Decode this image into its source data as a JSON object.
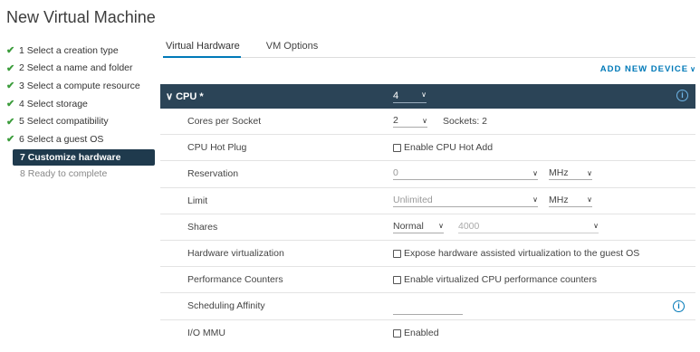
{
  "window": {
    "title": "New Virtual Machine"
  },
  "steps": [
    {
      "label": "1 Select a creation type",
      "done": true
    },
    {
      "label": "2 Select a name and folder",
      "done": true
    },
    {
      "label": "3 Select a compute resource",
      "done": true
    },
    {
      "label": "4 Select storage",
      "done": true
    },
    {
      "label": "5 Select compatibility",
      "done": true
    },
    {
      "label": "6 Select a guest OS",
      "done": true
    },
    {
      "label": "7 Customize hardware",
      "active": true
    },
    {
      "label": "8 Ready to complete",
      "future": true
    }
  ],
  "tabs": [
    {
      "label": "Virtual Hardware",
      "active": true
    },
    {
      "label": "VM Options"
    }
  ],
  "add_device": {
    "label": "ADD NEW DEVICE",
    "icon": "chevron-down-icon"
  },
  "cpu": {
    "header_label": "CPU *",
    "header_value": "4",
    "cores_per_socket": {
      "label": "Cores per Socket",
      "value": "2",
      "sockets_text": "Sockets: 2"
    },
    "hot_plug": {
      "label": "CPU Hot Plug",
      "checkbox_label": "Enable CPU Hot Add"
    },
    "reservation": {
      "label": "Reservation",
      "value": "0",
      "unit": "MHz"
    },
    "limit": {
      "label": "Limit",
      "value": "Unlimited",
      "unit": "MHz"
    },
    "shares": {
      "label": "Shares",
      "level": "Normal",
      "value": "4000"
    },
    "hw_virt": {
      "label": "Hardware virtualization",
      "checkbox_label": "Expose hardware assisted virtualization to the guest OS"
    },
    "perf_counters": {
      "label": "Performance Counters",
      "checkbox_label": "Enable virtualized CPU performance counters"
    },
    "sched_affinity": {
      "label": "Scheduling Affinity"
    },
    "iommu": {
      "label": "I/O MMU",
      "checkbox_label": "Enabled"
    }
  },
  "colors": {
    "accent": "#0079b8",
    "header_bg": "#2b4457",
    "check": "#3b9c3b",
    "active_step_bg": "#1f3a4d"
  }
}
